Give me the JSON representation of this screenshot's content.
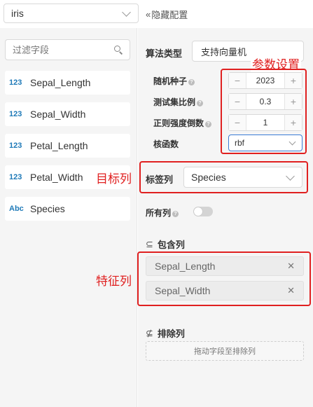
{
  "dataset_select": {
    "value": "iris"
  },
  "hide_config": {
    "icon": "double-chevron-left",
    "label": "隐藏配置"
  },
  "filter": {
    "placeholder": "过滤字段"
  },
  "fields": [
    {
      "type": "123",
      "name": "Sepal_Length"
    },
    {
      "type": "123",
      "name": "Sepal_Width"
    },
    {
      "type": "123",
      "name": "Petal_Length"
    },
    {
      "type": "123",
      "name": "Petal_Width"
    },
    {
      "type": "Abc",
      "name": "Species"
    }
  ],
  "algorithm": {
    "label": "算法类型",
    "value": "支持向量机"
  },
  "params": {
    "annotation": "参数设置",
    "seed": {
      "label": "随机种子",
      "value": "2023"
    },
    "test_ratio": {
      "label": "测试集比例",
      "value": "0.3"
    },
    "regularization": {
      "label": "正则强度倒数",
      "value": "1"
    },
    "kernel": {
      "label": "核函数",
      "value": "rbf"
    }
  },
  "target": {
    "annotation": "目标列",
    "label": "标签列",
    "value": "Species"
  },
  "all_columns": {
    "label": "所有列",
    "checked": false
  },
  "include": {
    "label": "包含列",
    "icon": "subset-icon",
    "annotation": "特征列",
    "chips": [
      "Sepal_Length",
      "Sepal_Width"
    ]
  },
  "exclude": {
    "label": "排除列",
    "icon": "not-subset-icon",
    "drop_hint": "拖动字段至排除列"
  },
  "colors": {
    "annotation_red": "#e02020",
    "type_blue": "#1f7ab8"
  }
}
